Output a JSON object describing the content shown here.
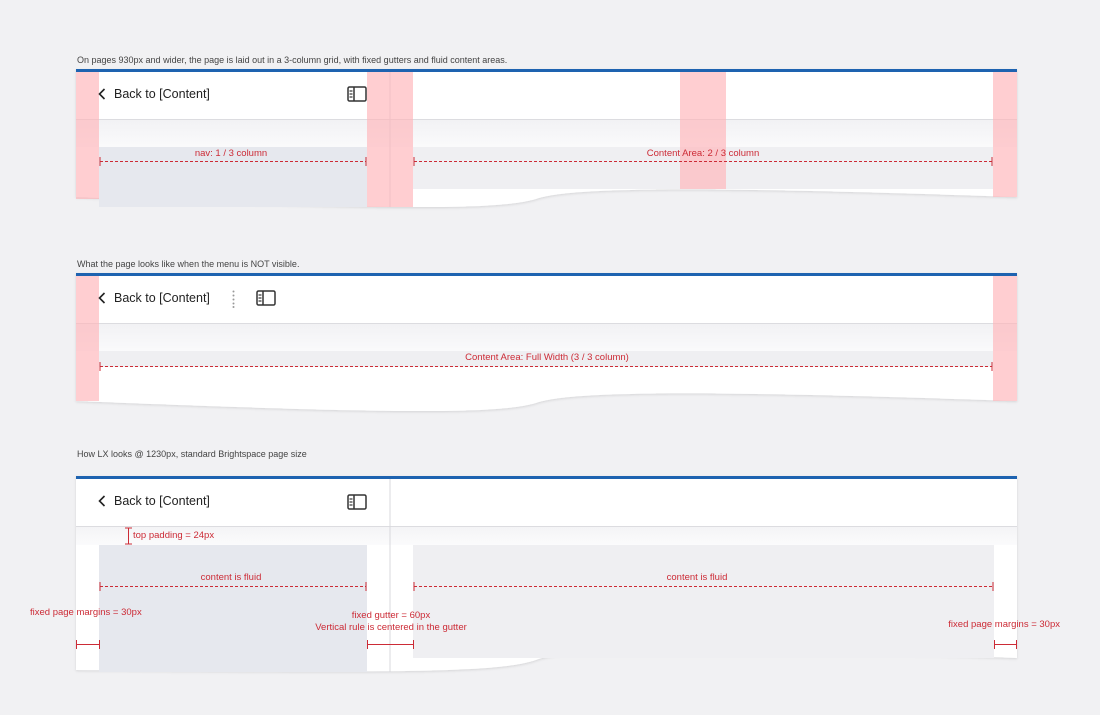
{
  "colors": {
    "background": "#f1f1f3",
    "top_bar": "#1e63b0",
    "gutter_overlay": "#ffb3b8",
    "annotation": "#cc2b36",
    "nav_fill": "#e6e8ee",
    "content_fill": "#efeff2"
  },
  "diagram1": {
    "caption": "On pages 930px and wider, the page is laid out in a 3-column grid, with fixed gutters and fluid content areas.",
    "back_label": "Back to [Content]",
    "back_icon": "chevron-left-icon",
    "toggle_icon": "sidebar-toggle-icon",
    "nav_label": "nav: 1 / 3 column",
    "content_label": "Content Area: 2 / 3 column"
  },
  "diagram2": {
    "caption": "What the page looks like when the menu is NOT visible.",
    "back_label": "Back to [Content]",
    "back_icon": "chevron-left-icon",
    "divider_icon": "vertical-dots-icon",
    "toggle_icon": "sidebar-toggle-icon",
    "content_label": "Content Area: Full Width (3 / 3 column)"
  },
  "diagram3": {
    "caption": "How LX looks @ 1230px, standard Brightspace page size",
    "back_label": "Back to [Content]",
    "back_icon": "chevron-left-icon",
    "toggle_icon": "sidebar-toggle-icon",
    "top_padding_label": "top padding = 24px",
    "nav_fluid_label": "content is fluid",
    "content_fluid_label": "content is fluid",
    "left_margin_label": "fixed page margins = 30px",
    "gutter_label_line1": "fixed gutter = 60px",
    "gutter_label_line2": "Vertical rule is centered in the gutter",
    "right_margin_label": "fixed page margins = 30px"
  }
}
